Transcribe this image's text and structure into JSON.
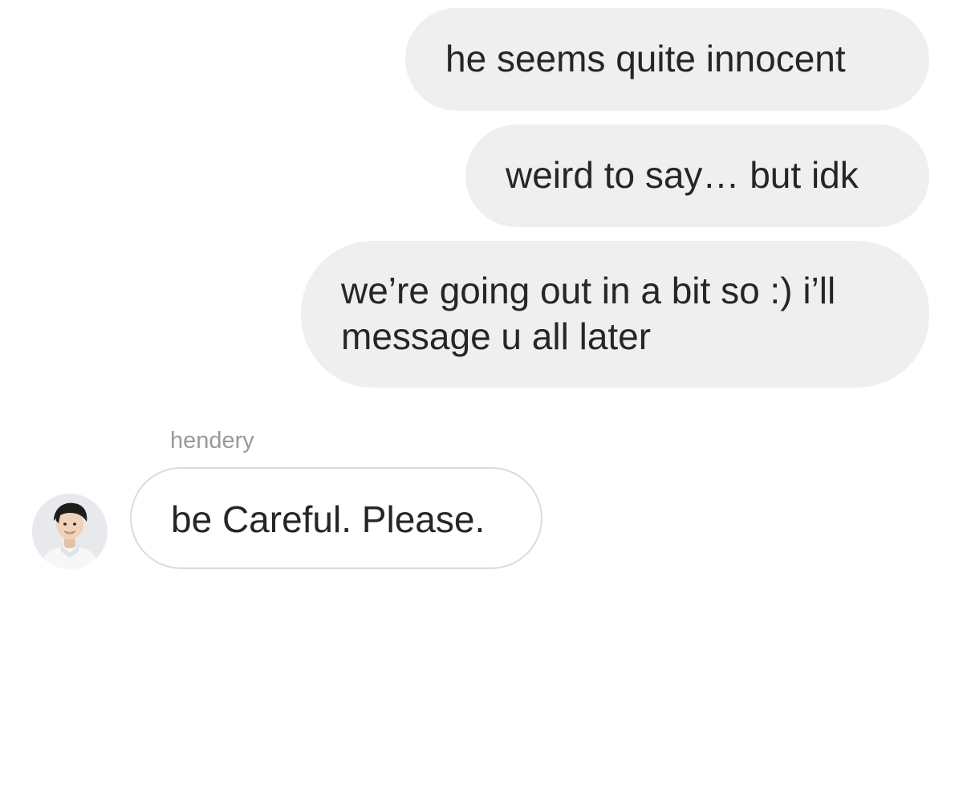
{
  "conversation": {
    "outgoing_messages": [
      {
        "text": "he seems quite innocent"
      },
      {
        "text": "weird to say… but idk"
      },
      {
        "text": "we’re going out in a bit so :) i’ll\nmessage u all later"
      }
    ],
    "incoming": {
      "sender_name": "hendery",
      "avatar": "profile-photo",
      "messages": [
        {
          "text": "be Careful. Please."
        }
      ]
    }
  },
  "colors": {
    "outgoing_bubble": "#efefef",
    "incoming_bubble_border": "#dbdbdb",
    "text": "#262626",
    "sender_name": "#999999"
  }
}
